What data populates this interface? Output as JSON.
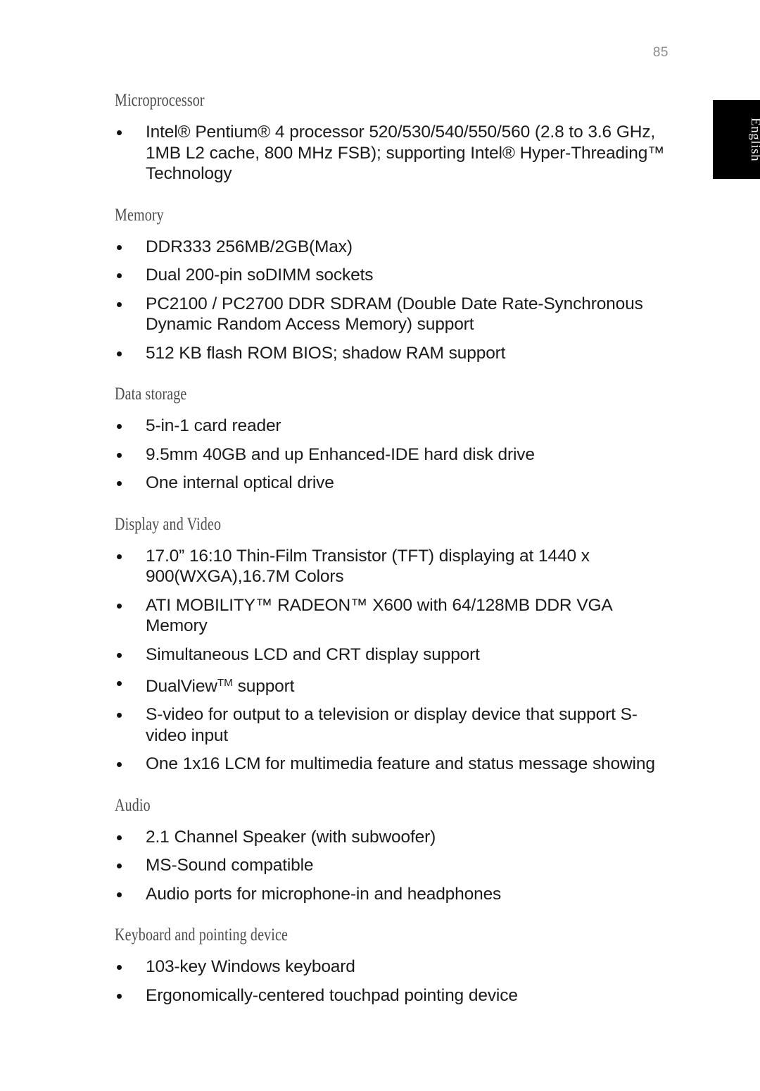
{
  "page": {
    "number": "85",
    "language_tab": "English"
  },
  "sections": [
    {
      "heading": "Microprocessor",
      "items": [
        "Intel® Pentium® 4 processor 520/530/540/550/560 (2.8 to 3.6 GHz, 1MB L2 cache, 800 MHz FSB); supporting Intel® Hyper-Threading™ Technology"
      ]
    },
    {
      "heading": "Memory",
      "items": [
        "DDR333 256MB/2GB(Max)",
        "Dual 200-pin soDIMM sockets",
        "PC2100 / PC2700 DDR SDRAM (Double Date Rate-Synchronous Dynamic Random Access Memory) support",
        "512 KB flash ROM BIOS; shadow RAM support"
      ]
    },
    {
      "heading": "Data storage",
      "items": [
        "5-in-1 card reader",
        "9.5mm 40GB and up Enhanced-IDE hard disk drive",
        "One internal optical drive"
      ]
    },
    {
      "heading": "Display and Video",
      "items": [
        "17.0”  16:10 Thin-Film Transistor (TFT) displaying at 1440 x 900(WXGA),16.7M Colors",
        "ATI MOBILITY™ RADEON™ X600 with 64/128MB DDR VGA Memory",
        "Simultaneous LCD and CRT display support",
        "DualView__TM__ support",
        "S-video for output to a television or display device that support S-video input",
        "One 1x16 LCM for multimedia feature and status message showing"
      ]
    },
    {
      "heading": "Audio",
      "items": [
        "2.1 Channel Speaker (with subwoofer)",
        "MS-Sound compatible",
        "Audio ports for microphone-in and headphones"
      ]
    },
    {
      "heading": "Keyboard and pointing device",
      "items": [
        "103-key Windows keyboard",
        "Ergonomically-centered touchpad pointing device"
      ]
    }
  ]
}
